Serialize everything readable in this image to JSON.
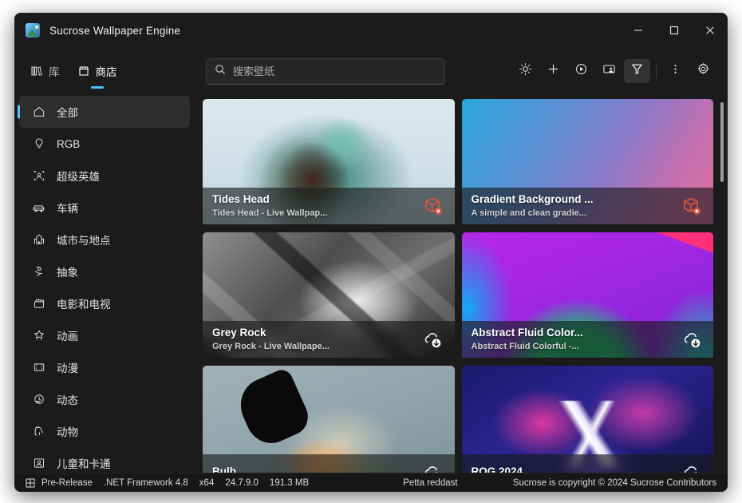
{
  "window": {
    "title": "Sucrose Wallpaper Engine",
    "app_icon": "wallpaper-app-icon",
    "minimize_label": "minimize-icon",
    "maximize_label": "maximize-icon",
    "close_label": "close-icon"
  },
  "nav": {
    "tabs": [
      {
        "label": "库",
        "icon": "library-icon",
        "active": false
      },
      {
        "label": "商店",
        "icon": "store-icon",
        "active": true
      }
    ]
  },
  "search": {
    "placeholder": "搜索壁纸",
    "value": "",
    "icon": "search-icon"
  },
  "toolbar": {
    "buttons": [
      {
        "name": "brightness-icon",
        "title": "brightness"
      },
      {
        "name": "plus-icon",
        "title": "add"
      },
      {
        "name": "play-circle-icon",
        "title": "play"
      },
      {
        "name": "monitor-person-icon",
        "title": "display"
      },
      {
        "name": "filter-funnel-icon",
        "title": "filter",
        "selected": true
      },
      {
        "name": "more-vertical-icon",
        "title": "more"
      },
      {
        "name": "gear-icon",
        "title": "settings"
      }
    ]
  },
  "sidebar": {
    "items": [
      {
        "label": "全部",
        "icon": "home-icon",
        "active": true
      },
      {
        "label": "RGB",
        "icon": "lightbulb-icon",
        "active": false
      },
      {
        "label": "超级英雄",
        "icon": "superhero-icon",
        "active": false
      },
      {
        "label": "车辆",
        "icon": "car-icon",
        "active": false
      },
      {
        "label": "城市与地点",
        "icon": "city-icon",
        "active": false
      },
      {
        "label": "抽象",
        "icon": "abstract-icon",
        "active": false
      },
      {
        "label": "电影和电视",
        "icon": "movie-icon",
        "active": false
      },
      {
        "label": "动画",
        "icon": "animation-star-icon",
        "active": false
      },
      {
        "label": "动漫",
        "icon": "film-strip-icon",
        "active": false
      },
      {
        "label": "动态",
        "icon": "motion-icon",
        "active": false
      },
      {
        "label": "动物",
        "icon": "animal-icon",
        "active": false
      },
      {
        "label": "儿童和卡通",
        "icon": "cartoon-icon",
        "active": false
      }
    ]
  },
  "gallery": {
    "cards": [
      {
        "title": "Tides Head",
        "subtitle": "Tides Head - Live Wallpap...",
        "thumb_class": "th-tides",
        "badge": "package-error-icon",
        "badge_color": "#e0553b"
      },
      {
        "title": "Gradient Background ...",
        "subtitle": "A simple and clean gradie...",
        "thumb_class": "th-gradient",
        "badge": "package-error-icon",
        "badge_color": "#e0553b"
      },
      {
        "title": "Grey Rock",
        "subtitle": "Grey Rock - Live Wallpape...",
        "thumb_class": "th-rock",
        "badge": "cloud-download-icon",
        "badge_color": "#ffffff"
      },
      {
        "title": "Abstract Fluid Color...",
        "subtitle": "Abstract Fluid Colorful -...",
        "thumb_class": "th-fluid",
        "badge": "cloud-download-icon",
        "badge_color": "#ffffff"
      },
      {
        "title": "Bulb",
        "subtitle": "",
        "thumb_class": "th-bulb",
        "badge": "cloud-download-icon",
        "badge_color": "#ffffff"
      },
      {
        "title": "ROG 2024",
        "subtitle": "",
        "thumb_class": "th-rog",
        "badge": "cloud-download-icon",
        "badge_color": "#ffffff"
      }
    ]
  },
  "statusbar": {
    "grid_icon": "grid-icon",
    "release": "Pre-Release",
    "framework": ".NET Framework 4.8",
    "arch": "x64",
    "version": "24.7.9.0",
    "memory": "191.3 MB",
    "center": "Petta reddast",
    "copyright": "Sucrose is copyright © 2024 Sucrose Contributors"
  },
  "colors": {
    "accent": "#4cc2ff",
    "window_bg": "#1b1b1b",
    "status_bg": "#171717",
    "error": "#e0553b"
  }
}
